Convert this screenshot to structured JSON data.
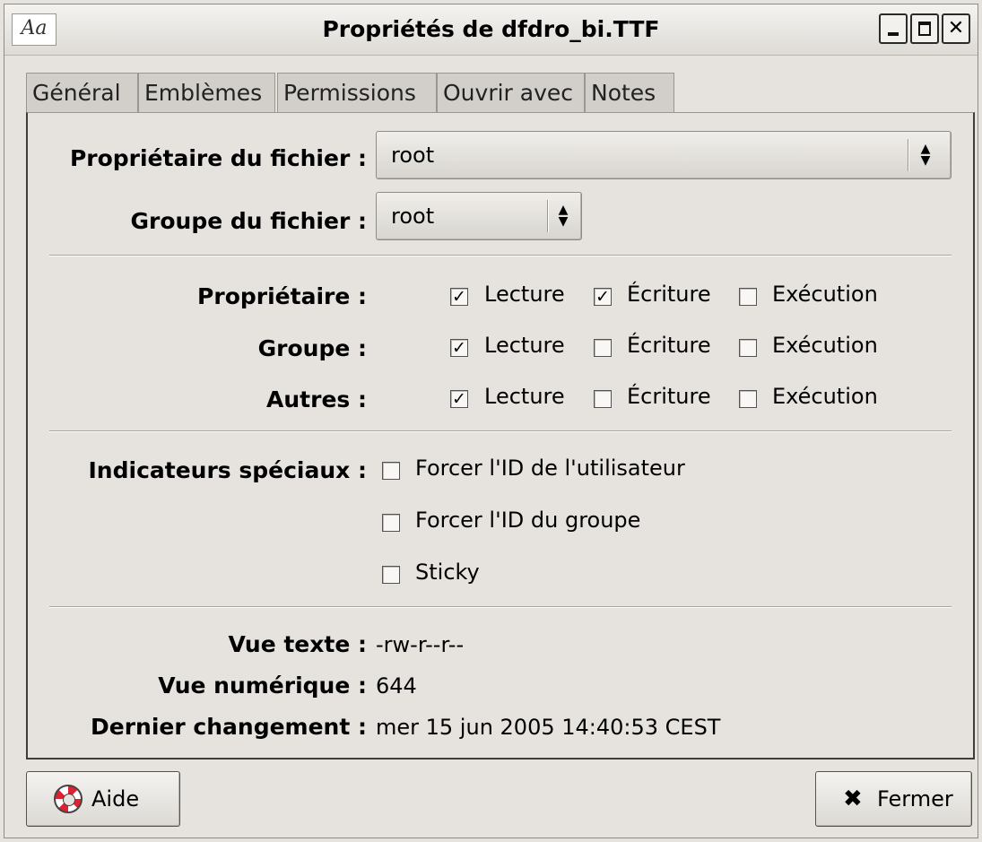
{
  "window": {
    "title": "Propriétés de dfdro_bi.TTF",
    "app_icon_text": "Aa",
    "minimize_icon": "minimize-icon",
    "maximize_icon": "maximize-icon",
    "close_glyph": "✕"
  },
  "tabs": [
    {
      "label": "Général"
    },
    {
      "label": "Emblèmes"
    },
    {
      "label": "Permissions",
      "active": true
    },
    {
      "label": "Ouvrir avec"
    },
    {
      "label": "Notes"
    }
  ],
  "ownership": {
    "owner_label": "Propriétaire du fichier :",
    "owner_value": "root",
    "group_label": "Groupe du fichier :",
    "group_value": "root"
  },
  "permissions": {
    "rows": [
      {
        "label": "Propriétaire :",
        "read": true,
        "write": true,
        "exec": false
      },
      {
        "label": "Groupe :",
        "read": true,
        "write": false,
        "exec": false
      },
      {
        "label": "Autres :",
        "read": true,
        "write": false,
        "exec": false
      }
    ],
    "read_label": "Lecture",
    "write_label": "Écriture",
    "exec_label": "Exécution"
  },
  "special": {
    "label": "Indicateurs spéciaux :",
    "flags": [
      {
        "label": "Forcer l'ID de l'utilisateur",
        "checked": false
      },
      {
        "label": "Forcer l'ID du groupe",
        "checked": false
      },
      {
        "label": "Sticky",
        "checked": false
      }
    ]
  },
  "info": {
    "text_view_label": "Vue texte :",
    "text_view_value": "-rw-r--r--",
    "numeric_view_label": "Vue numérique :",
    "numeric_view_value": "644",
    "last_change_label": "Dernier changement :",
    "last_change_value": "mer 15 jun 2005 14:40:53 CEST"
  },
  "buttons": {
    "help_label": "Aide",
    "close_label": "Fermer",
    "close_glyph": "✖"
  },
  "check_glyph": "✓"
}
